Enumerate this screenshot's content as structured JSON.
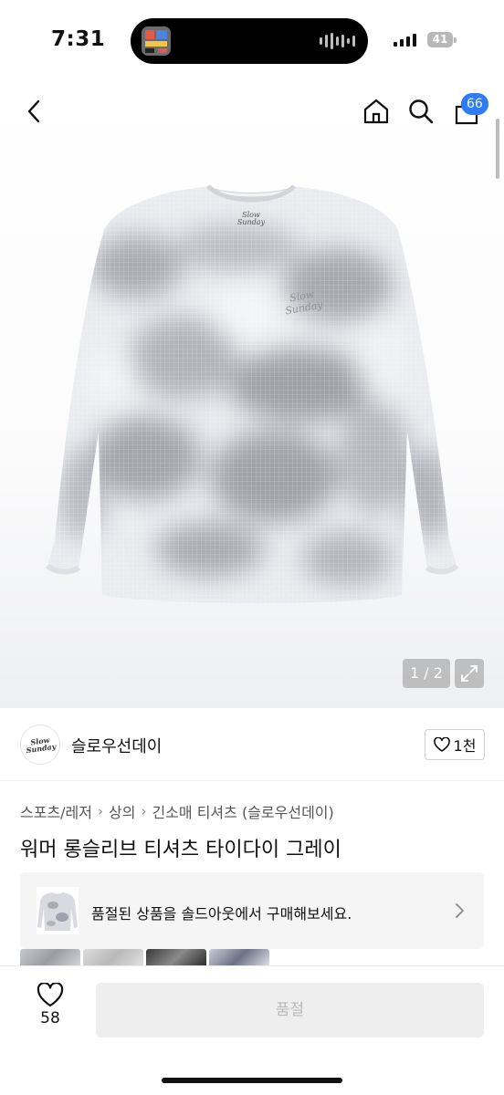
{
  "status_bar": {
    "time": "7:31",
    "battery": "41"
  },
  "nav": {
    "cart_count": "66",
    "icons": [
      "back-chevron-icon",
      "home-icon",
      "search-icon",
      "shopping-bag-icon"
    ]
  },
  "gallery": {
    "counter": "1 / 2",
    "current": 1,
    "total": 2,
    "shirt_logo": [
      "Slow",
      "Sunday"
    ]
  },
  "brand": {
    "logo_text": [
      "Slow",
      "Sunday"
    ],
    "name": "슬로우선데이",
    "like_count": "1천"
  },
  "breadcrumb": [
    "스포츠/레저",
    "상의",
    "긴소매 티셔츠 (슬로우선데이)"
  ],
  "product": {
    "title": "워머 롱슬리브 티셔츠 타이다이 그레이"
  },
  "soldout_banner": {
    "text": "품절된 상품을 솔드아웃에서 구매해보세요."
  },
  "bottom_bar": {
    "wish_count": "58",
    "buy_label": "품절"
  },
  "colors": {
    "accent": "#2d7cf6",
    "disabled_bg": "#eeeeee",
    "disabled_text": "#b9b9b9"
  }
}
